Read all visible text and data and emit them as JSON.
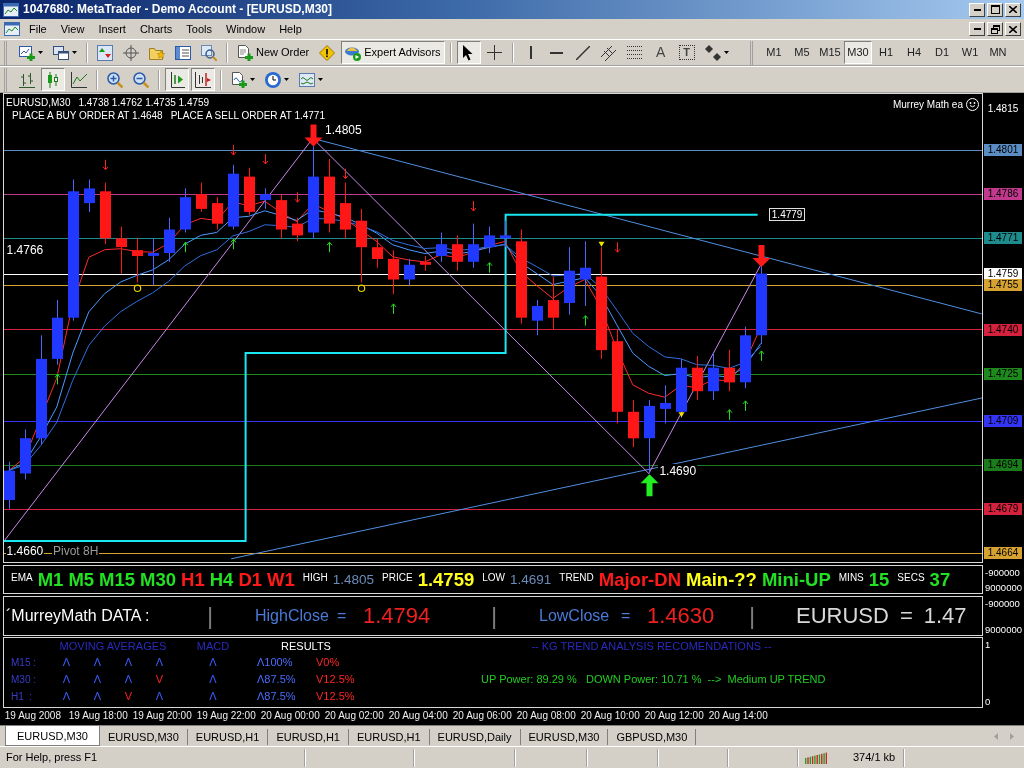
{
  "window": {
    "title": "1047680: MetaTrader - Demo Account - [EURUSD,M30]"
  },
  "menu": [
    {
      "label": "File"
    },
    {
      "label": "View"
    },
    {
      "label": "Insert"
    },
    {
      "label": "Charts"
    },
    {
      "label": "Tools"
    },
    {
      "label": "Window"
    },
    {
      "label": "Help"
    }
  ],
  "toolbars": [
    {
      "buttons": [
        {
          "kind": "new-chart",
          "pressed": false,
          "dropdown": true
        },
        {
          "kind": "profiles",
          "pressed": false,
          "dropdown": true
        },
        {
          "kind": "separator"
        },
        {
          "kind": "market-watch",
          "pressed": false
        },
        {
          "kind": "data-window",
          "pressed": false
        },
        {
          "kind": "navigator",
          "pressed": false
        },
        {
          "kind": "terminal",
          "pressed": false
        },
        {
          "kind": "strategy-tester",
          "pressed": false
        },
        {
          "kind": "separator"
        },
        {
          "kind": "new-order",
          "label": "New Order",
          "pressed": false
        },
        {
          "kind": "alert",
          "pressed": false
        },
        {
          "kind": "expert-advisors",
          "label": "Expert Advisors",
          "pressed": true
        },
        {
          "kind": "separator"
        },
        {
          "kind": "cursor",
          "pressed": true
        },
        {
          "kind": "crosshair",
          "pressed": false
        },
        {
          "kind": "separator"
        },
        {
          "kind": "vertical-line",
          "pressed": false
        },
        {
          "kind": "horizontal-line",
          "pressed": false
        },
        {
          "kind": "trend-line",
          "pressed": false
        },
        {
          "kind": "channel",
          "pressed": false
        },
        {
          "kind": "fibonacci",
          "pressed": false
        },
        {
          "kind": "text",
          "label": "A",
          "pressed": false
        },
        {
          "kind": "text-label",
          "label": "T",
          "pressed": false
        },
        {
          "kind": "arrows",
          "pressed": false,
          "dropdown": true
        }
      ]
    },
    {
      "buttons": [
        {
          "kind": "bar-chart",
          "pressed": false
        },
        {
          "kind": "candlesticks",
          "pressed": true
        },
        {
          "kind": "line-chart",
          "pressed": false
        },
        {
          "kind": "separator"
        },
        {
          "kind": "zoom-in",
          "pressed": false
        },
        {
          "kind": "zoom-out",
          "pressed": false
        },
        {
          "kind": "separator"
        },
        {
          "kind": "auto-scroll",
          "pressed": true
        },
        {
          "kind": "chart-shift",
          "pressed": true
        },
        {
          "kind": "separator"
        },
        {
          "kind": "indicators",
          "pressed": false,
          "dropdown": true
        },
        {
          "kind": "periods",
          "pressed": false,
          "dropdown": true
        },
        {
          "kind": "templates",
          "pressed": false,
          "dropdown": true
        }
      ]
    }
  ],
  "timeframes": [
    {
      "label": "M1",
      "selected": false
    },
    {
      "label": "M5",
      "selected": false
    },
    {
      "label": "M15",
      "selected": false
    },
    {
      "label": "M30",
      "selected": true
    },
    {
      "label": "H1",
      "selected": false
    },
    {
      "label": "H4",
      "selected": false
    },
    {
      "label": "D1",
      "selected": false
    },
    {
      "label": "W1",
      "selected": false
    },
    {
      "label": "MN",
      "selected": false
    }
  ],
  "chart": {
    "header": {
      "symbol": "EURUSD,M30",
      "ohlc": "1.4738 1.4762 1.4735 1.4759"
    },
    "messages": [
      "PLACE A BUY ORDER AT 1.4648",
      "PLACE A SELL ORDER AT 1.4771"
    ],
    "expert": {
      "label": "Murrey Math ea",
      "running": true
    },
    "price_axis": [
      {
        "label": "1.4815"
      },
      {
        "label": "1.4801",
        "color": "#5b8cc4"
      },
      {
        "label": "1.4786",
        "color": "#c23a8e"
      },
      {
        "label": "1.4771",
        "color": "#1e8c8c"
      },
      {
        "label": "1.4759",
        "color": "#ffffff"
      },
      {
        "label": "1.4755",
        "color": "#d6a232"
      },
      {
        "label": "1.4740",
        "color": "#d4223e"
      },
      {
        "label": "1.4725",
        "color": "#1e8a1e"
      },
      {
        "label": "1.4709",
        "color": "#3434f4"
      },
      {
        "label": "1.4694",
        "color": "#1a7c1a"
      },
      {
        "label": "1.4679",
        "color": "#d4223e"
      },
      {
        "label": "1.4664",
        "color": "#d6a232"
      }
    ],
    "time_axis": [
      "19 Aug 2008",
      "19 Aug 18:00",
      "19 Aug 20:00",
      "19 Aug 22:00",
      "20 Aug 00:00",
      "20 Aug 02:00",
      "20 Aug 04:00",
      "20 Aug 06:00",
      "20 Aug 08:00",
      "20 Aug 10:00",
      "20 Aug 12:00",
      "20 Aug 14:00"
    ],
    "annotations": [
      {
        "text": "1.4805",
        "color": "#ffffff"
      },
      {
        "text": "1.4690",
        "color": "#ffffff"
      },
      {
        "text": "1.4779",
        "color": "#ffffff",
        "boxed": true
      },
      {
        "text": "1.4766",
        "color": "#ffffff"
      },
      {
        "text": "1.4660",
        "color": "#ffffff"
      },
      {
        "text": "Pivot 8H",
        "color": "#9a9a9a"
      }
    ]
  },
  "panels": [
    {
      "kind": "signals",
      "items": [
        {
          "kind": "caption",
          "text": "EMA"
        },
        {
          "kind": "signal",
          "text": "M1",
          "color": "#22e022"
        },
        {
          "kind": "signal",
          "text": "M5",
          "color": "#22e022"
        },
        {
          "kind": "signal",
          "text": "M15",
          "color": "#22e022"
        },
        {
          "kind": "signal",
          "text": "M30",
          "color": "#22e022"
        },
        {
          "kind": "signal",
          "text": "H1",
          "color": "#ff1a1a"
        },
        {
          "kind": "signal",
          "text": "H4",
          "color": "#22e022"
        },
        {
          "kind": "signal",
          "text": "D1",
          "color": "#ff1a1a"
        },
        {
          "kind": "signal",
          "text": "W1",
          "color": "#ff1a1a"
        },
        {
          "kind": "caption",
          "text": "HIGH"
        },
        {
          "kind": "quote",
          "text": "1.4805",
          "color": "#6b8cba"
        },
        {
          "kind": "caption",
          "text": "PRICE"
        },
        {
          "kind": "signal",
          "text": "1.4759",
          "color": "#ffff1a"
        },
        {
          "kind": "caption",
          "text": "LOW"
        },
        {
          "kind": "quote",
          "text": "1.4691",
          "color": "#6b8cba"
        },
        {
          "kind": "caption",
          "text": "TREND"
        },
        {
          "kind": "signal",
          "text": "Major-DN",
          "color": "#ff1a1a"
        },
        {
          "kind": "signal",
          "text": "Main-??",
          "color": "#ffff1a"
        },
        {
          "kind": "signal",
          "text": "Mini-UP",
          "color": "#22e022"
        },
        {
          "kind": "caption",
          "text": "MINS"
        },
        {
          "kind": "signal",
          "text": "15",
          "color": "#22e022"
        },
        {
          "kind": "caption",
          "text": "SECS"
        },
        {
          "kind": "signal",
          "text": "37",
          "color": "#22e022"
        }
      ],
      "scale": [
        "-900000",
        "9000000"
      ]
    },
    {
      "kind": "murrey",
      "title": "´MurreyMath DATA :",
      "cells": [
        {
          "kind": "level",
          "divider": "|",
          "name": "HighClose",
          "sign": "=",
          "value": "1.4794"
        },
        {
          "kind": "level",
          "divider": "|",
          "name": "LowClose",
          "sign": "=",
          "value": "1.4630"
        },
        {
          "kind": "quote",
          "divider": "|",
          "name": "EURUSD",
          "sign": "=",
          "value": "1.47"
        }
      ],
      "scale": [
        "-900000",
        "9000000"
      ]
    },
    {
      "kind": "analysis",
      "columns": [
        {
          "text": "MOVING AVERAGES",
          "kind": "group"
        },
        {
          "text": "MACD",
          "kind": "group"
        },
        {
          "text": "RESULTS",
          "kind": "result"
        }
      ],
      "title": "-- KG TREND ANALYSIS RECOMENDATIONS --",
      "rows": [
        {
          "label": "M15 :",
          "ma": [
            {
              "text": "Λ",
              "kind": "up"
            },
            {
              "text": "Λ",
              "kind": "up"
            },
            {
              "text": "Λ",
              "kind": "up"
            },
            {
              "text": "Λ",
              "kind": "up"
            }
          ],
          "macd": {
            "text": "Λ",
            "kind": "up"
          },
          "up_share": "Λ100%",
          "down_share": "V0%"
        },
        {
          "label": "M30 :",
          "ma": [
            {
              "text": "Λ",
              "kind": "up"
            },
            {
              "text": "Λ",
              "kind": "up"
            },
            {
              "text": "Λ",
              "kind": "up"
            },
            {
              "text": "V",
              "kind": "down"
            }
          ],
          "macd": {
            "text": "Λ",
            "kind": "up"
          },
          "up_share": "Λ87.5%",
          "down_share": "V12.5%",
          "summary": "UP Power: 89.29 %   DOWN Power: 10.71 %  -->  Medium UP TREND"
        },
        {
          "label": "H1  :",
          "ma": [
            {
              "text": "Λ",
              "kind": "up"
            },
            {
              "text": "Λ",
              "kind": "up"
            },
            {
              "text": "V",
              "kind": "down"
            },
            {
              "text": "Λ",
              "kind": "up"
            }
          ],
          "macd": {
            "text": "Λ",
            "kind": "up"
          },
          "up_share": "Λ87.5%",
          "down_share": "V12.5%"
        }
      ],
      "scale": [
        "1",
        "0"
      ]
    }
  ],
  "tabs": [
    {
      "label": "EURUSD,M30",
      "selected": true
    },
    {
      "label": "EURUSD,M30",
      "selected": false
    },
    {
      "label": "EURUSD,H1",
      "selected": false
    },
    {
      "label": "EURUSD,H1",
      "selected": false
    },
    {
      "label": "EURUSD,H1",
      "selected": false
    },
    {
      "label": "EURUSD,Daily",
      "selected": false
    },
    {
      "label": "EURUSD,M30",
      "selected": false
    },
    {
      "label": "GBPUSD,M30",
      "selected": false
    }
  ],
  "tab_scroll": [
    {
      "kind": "left",
      "disabled": true
    },
    {
      "kind": "right",
      "disabled": true
    }
  ],
  "status_bar": {
    "help": "For Help, press F1",
    "traffic": "374/1 kb"
  }
}
